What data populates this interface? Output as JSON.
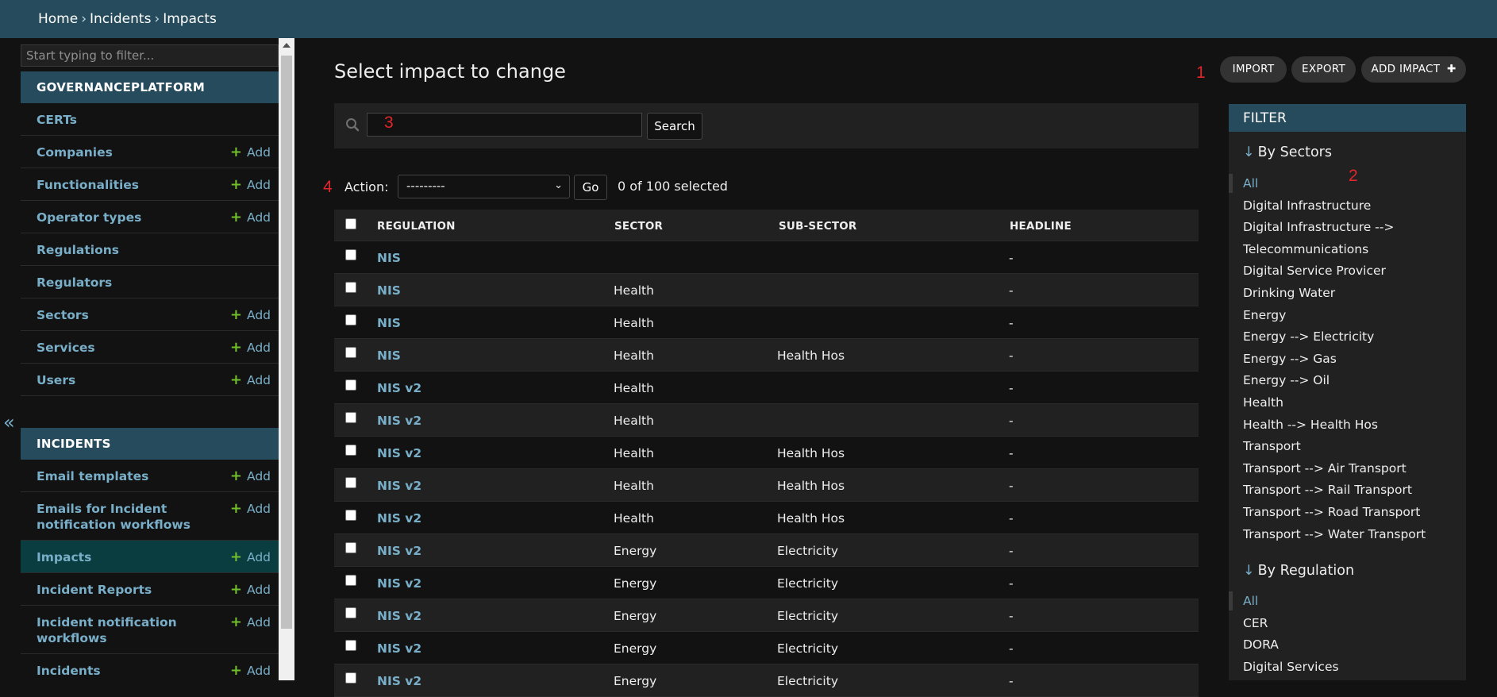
{
  "breadcrumbs": {
    "home": "Home",
    "sep": "›",
    "incidents": "Incidents",
    "current": "Impacts"
  },
  "sidebar": {
    "filter_placeholder": "Start typing to filter...",
    "toggle_icon": "«",
    "add_label": "Add",
    "modules": [
      {
        "caption": "GOVERNANCEPLATFORM",
        "items": [
          {
            "label": "CERTs",
            "add": false
          },
          {
            "label": "Companies",
            "add": true
          },
          {
            "label": "Functionalities",
            "add": true
          },
          {
            "label": "Operator types",
            "add": true
          },
          {
            "label": "Regulations",
            "add": false
          },
          {
            "label": "Regulators",
            "add": false
          },
          {
            "label": "Sectors",
            "add": true
          },
          {
            "label": "Services",
            "add": true
          },
          {
            "label": "Users",
            "add": true
          }
        ]
      },
      {
        "caption": "INCIDENTS",
        "items": [
          {
            "label": "Email templates",
            "add": true
          },
          {
            "label": "Emails for Incident notification workflows",
            "add": true
          },
          {
            "label": "Impacts",
            "add": true,
            "current": true
          },
          {
            "label": "Incident Reports",
            "add": true
          },
          {
            "label": "Incident notification workflows",
            "add": true
          },
          {
            "label": "Incidents",
            "add": true
          }
        ]
      }
    ]
  },
  "main": {
    "title": "Select impact to change",
    "tools": {
      "import": "IMPORT",
      "export": "EXPORT",
      "add": "ADD IMPACT",
      "add_icon": "✚"
    },
    "search": {
      "value": "",
      "button": "Search"
    },
    "actions": {
      "label": "Action:",
      "selected": "---------",
      "go": "Go",
      "count": "0 of 100 selected"
    },
    "table": {
      "columns": [
        "REGULATION",
        "SECTOR",
        "SUB-SECTOR",
        "HEADLINE"
      ],
      "rows": [
        [
          "NIS",
          "",
          "",
          "-"
        ],
        [
          "NIS",
          "Health",
          "",
          "-"
        ],
        [
          "NIS",
          "Health",
          "",
          "-"
        ],
        [
          "NIS",
          "Health",
          "Health Hos",
          "-"
        ],
        [
          "NIS v2",
          "Health",
          "",
          "-"
        ],
        [
          "NIS v2",
          "Health",
          "",
          "-"
        ],
        [
          "NIS v2",
          "Health",
          "Health Hos",
          "-"
        ],
        [
          "NIS v2",
          "Health",
          "Health Hos",
          "-"
        ],
        [
          "NIS v2",
          "Health",
          "Health Hos",
          "-"
        ],
        [
          "NIS v2",
          "Energy",
          "Electricity",
          "-"
        ],
        [
          "NIS v2",
          "Energy",
          "Electricity",
          "-"
        ],
        [
          "NIS v2",
          "Energy",
          "Electricity",
          "-"
        ],
        [
          "NIS v2",
          "Energy",
          "Electricity",
          "-"
        ],
        [
          "NIS v2",
          "Energy",
          "Electricity",
          "-"
        ]
      ]
    }
  },
  "filter": {
    "title": "FILTER",
    "arrow": "↓",
    "by_sectors": {
      "title": "By Sectors",
      "items": [
        "All",
        "Digital Infrastructure",
        "Digital Infrastructure -->",
        "Telecommunications",
        "Digital Service Provicer",
        "Drinking Water",
        "Energy",
        "Energy --> Electricity",
        "Energy --> Gas",
        "Energy --> Oil",
        "Health",
        "Health --> Health Hos",
        "Transport",
        "Transport --> Air Transport",
        "Transport --> Rail Transport",
        "Transport --> Road Transport",
        "Transport --> Water Transport"
      ]
    },
    "by_regulation": {
      "title": "By Regulation",
      "items": [
        "All",
        "CER",
        "DORA",
        "Digital Services"
      ]
    }
  },
  "annotations": [
    "1",
    "2",
    "3",
    "4"
  ],
  "colors": {
    "header": "#264b5d",
    "link": "#79aec8",
    "add_plus": "#70bf2b",
    "annotation": "#e0252b"
  }
}
